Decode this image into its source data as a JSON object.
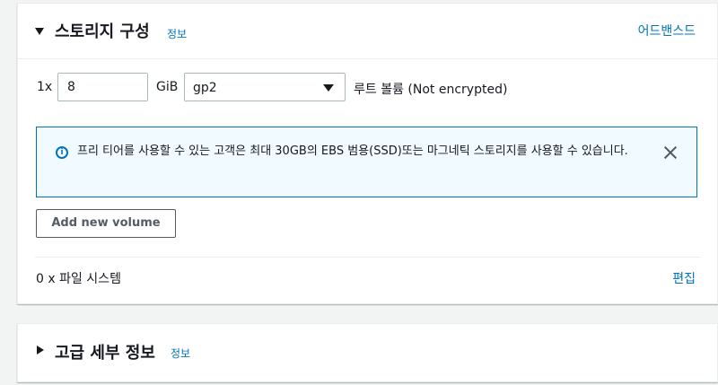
{
  "storage": {
    "title": "스토리지 구성",
    "info": "정보",
    "advanced_link": "어드밴스드",
    "volume": {
      "count": "1x",
      "size": "8",
      "unit": "GiB",
      "type": "gp2",
      "description": "루트 볼륨  (Not encrypted)"
    },
    "alert": {
      "icon": "info-icon",
      "text": "프리 티어를 사용할 수 있는 고객은 최대 30GB의 EBS 범용(SSD)또는 마그네틱 스토리지를 사용할 수 있습니다."
    },
    "add_volume_label": "Add new volume",
    "file_systems": "0 x 파일 시스템",
    "edit_label": "편집"
  },
  "advanced": {
    "title": "고급 세부 정보",
    "info": "정보"
  },
  "colors": {
    "link": "#0073bb",
    "alert_bg": "#f1faff",
    "alert_border": "#0073bb"
  }
}
